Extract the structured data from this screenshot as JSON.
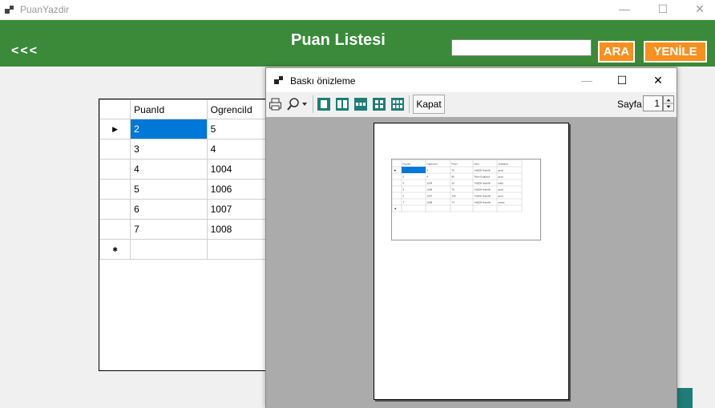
{
  "window": {
    "title": "PuanYazdir",
    "min": "—",
    "max": "☐",
    "close": "✕"
  },
  "header": {
    "back_label": "<<<",
    "title": "Puan Listesi",
    "search_value": "",
    "search_button": "ARA",
    "refresh_button": "YENİLE"
  },
  "colors": {
    "header_green": "#3a8a3a",
    "button_orange": "#f7901e",
    "selection_blue": "#0078d7",
    "teal": "#1e7d76"
  },
  "grid": {
    "columns": [
      "PuanId",
      "OgrenciId"
    ],
    "rows": [
      {
        "PuanId": "2",
        "OgrenciId": "5"
      },
      {
        "PuanId": "3",
        "OgrenciId": "4"
      },
      {
        "PuanId": "4",
        "OgrenciId": "1004"
      },
      {
        "PuanId": "5",
        "OgrenciId": "1006"
      },
      {
        "PuanId": "6",
        "OgrenciId": "1007"
      },
      {
        "PuanId": "7",
        "OgrenciId": "1008"
      }
    ],
    "current_row_marker": "▶",
    "new_row_marker": "✱"
  },
  "dialog": {
    "title": "Baskı önizleme",
    "close_button": "Kapat",
    "page_label": "Sayfa",
    "page_value": "1",
    "toolbar_icons": [
      "print-icon",
      "zoom-icon",
      "one-page-icon",
      "two-pages-icon",
      "three-pages-icon",
      "four-pages-icon",
      "six-pages-icon"
    ]
  },
  "preview_table": {
    "headers": [
      "PuanId",
      "OgrenciId",
      "Puan",
      "Ders",
      "Aciklama"
    ],
    "rows": [
      [
        "2",
        "5",
        "70",
        "YildIZH Hazirlik",
        "gecti"
      ],
      [
        "3",
        "4",
        "80",
        "Temel Ingilizce",
        "gecti"
      ],
      [
        "4",
        "1004",
        "20",
        "YildIZH Hazirlik",
        "kaldi"
      ],
      [
        "5",
        "1006",
        "75",
        "YildIZH Hazirlik",
        "gecti"
      ],
      [
        "6",
        "1007",
        "100",
        "YildIZH Hazirlik",
        "gecti"
      ],
      [
        "7",
        "1008",
        "74",
        "YildIZH Hazirlik",
        "yesas"
      ]
    ]
  }
}
